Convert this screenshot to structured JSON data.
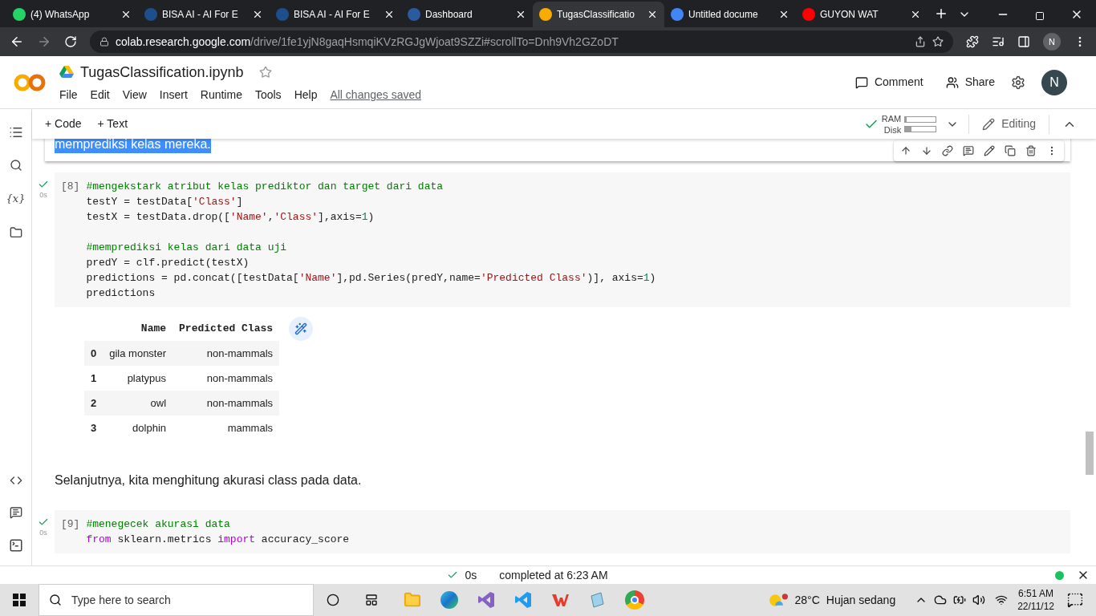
{
  "browser_tabs": [
    {
      "title": "(4) WhatsApp",
      "selected": false
    },
    {
      "title": "BISA AI - AI For E",
      "selected": false
    },
    {
      "title": "BISA AI - AI For E",
      "selected": false
    },
    {
      "title": "Dashboard",
      "selected": false
    },
    {
      "title": "TugasClassificatio",
      "selected": true
    },
    {
      "title": "Untitled docume",
      "selected": false
    },
    {
      "title": "GUYON WAT",
      "selected": false
    }
  ],
  "sidebar": {
    "variables_label": "{x}"
  },
  "address_bar": {
    "host": "colab.research.google.com",
    "path": "/drive/1fe1yjN8gaqHsmqiKVzRGJgWjoat9SZZi#scrollTo=Dnh9Vh2GZoDT"
  },
  "profile_initial": "N",
  "notebook": {
    "title": "TugasClassification.ipynb",
    "menu": [
      "File",
      "Edit",
      "View",
      "Insert",
      "Runtime",
      "Tools",
      "Help"
    ],
    "save_status": "All changes saved"
  },
  "header_actions": {
    "comment": "Comment",
    "share": "Share",
    "avatar": "N"
  },
  "toolbar": {
    "add_code": "+ Code",
    "add_text": "+ Text",
    "ram_label": "RAM",
    "ram": {
      "level": 0.05
    },
    "disk_label": "Disk",
    "disk": {
      "level": 0.2
    },
    "mode": "Editing"
  },
  "text_cell_top": "memprediksi kelas mereka.",
  "cell_8": {
    "number": "[8]",
    "time": "0s",
    "blocks": [
      [
        [
          "#mengekstark atribut kelas prediktor dan target dari data"
        ],
        [
          "testY = testData[",
          "'Class'",
          "]"
        ],
        [
          "testX = testData.drop([",
          "'Name'",
          ",",
          "'Class'",
          "],axis=",
          "1",
          ")"
        ]
      ],
      [
        [
          "#memprediksi kelas dari data uji"
        ],
        [
          "predY = clf.predict(testX)"
        ],
        [
          "predictions = pd.concat([testData[",
          "'Name'",
          "],pd.Series(predY,name=",
          "'Predicted Class'",
          ")], axis=",
          "1",
          ")"
        ],
        [
          "predictions"
        ]
      ]
    ]
  },
  "output_table": {
    "columns": [
      "Name",
      "Predicted Class"
    ],
    "rows": [
      {
        "index": "0",
        "name": "gila monster",
        "predicted": "non-mammals"
      },
      {
        "index": "1",
        "name": "platypus",
        "predicted": "non-mammals"
      },
      {
        "index": "2",
        "name": "owl",
        "predicted": "non-mammals"
      },
      {
        "index": "3",
        "name": "dolphin",
        "predicted": "mammals"
      }
    ]
  },
  "text_cell": "Selanjutnya, kita menghitung akurasi class pada data.",
  "cell_9": {
    "number": "[9]",
    "time": "0s",
    "blocks": [
      [
        [
          "#menegecek akurasi data"
        ],
        [
          "from",
          " sklearn.metrics ",
          "import",
          " accuracy_score"
        ]
      ]
    ]
  },
  "status_bar": {
    "time": "0s",
    "message": "completed at 6:23 AM"
  },
  "taskbar": {
    "search_placeholder": "Type here to search",
    "temperature": "28°C",
    "weather": "Hujan sedang",
    "clock": "6:51 AM",
    "date": "22/11/12"
  }
}
